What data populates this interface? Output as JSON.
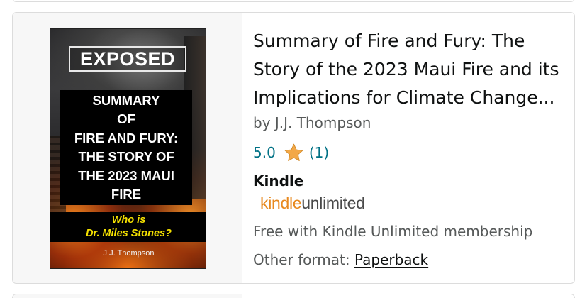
{
  "product": {
    "title": "Summary of Fire and Fury: The Story of the 2023 Maui Fire and its Implications for Climate Change...",
    "byline": "by J.J. Thompson",
    "rating": {
      "value": "5.0",
      "count": "(1)",
      "star_color": "#f3a847",
      "star_icon": "star-icon"
    },
    "format": "Kindle",
    "kindle_unlimited": {
      "kindle": "kindle",
      "unlimited": "unlimited",
      "kindle_color": "#e8891f"
    },
    "membership_text": "Free with Kindle Unlimited membership",
    "other_format": {
      "label": "Other format: ",
      "link": "Paperback"
    }
  },
  "cover": {
    "exposed": "EXPOSED",
    "title_lines": "SUMMARY\nOF\nFIRE AND FURY:\nTHE STORY OF\nTHE 2023 MAUI\nFIRE",
    "tagline": "Who is\nDr. Miles Stones?",
    "author": "J.J. Thompson",
    "tagline_color": "#f4e000"
  },
  "colors": {
    "link": "#007185",
    "secondary_text": "#565959",
    "primary_text": "#0f1111"
  }
}
